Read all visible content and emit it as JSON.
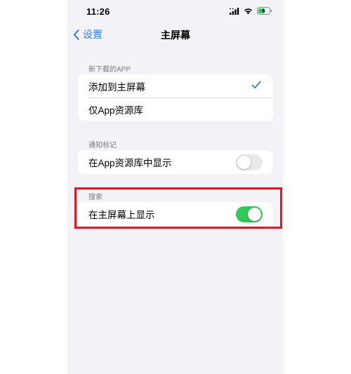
{
  "status_bar": {
    "time": "11:26"
  },
  "nav": {
    "back_label": "设置",
    "title": "主屏幕"
  },
  "sections": {
    "new_downloads": {
      "header": "新下载的APP",
      "rows": [
        {
          "label": "添加到主屏幕",
          "selected": true
        },
        {
          "label": "仅App资源库",
          "selected": false
        }
      ]
    },
    "notification_badges": {
      "header": "通知标记",
      "rows": [
        {
          "label": "在App资源库中显示",
          "toggle": false
        }
      ]
    },
    "search": {
      "header": "搜索",
      "rows": [
        {
          "label": "在主屏幕上显示",
          "toggle": true
        }
      ]
    }
  },
  "colors": {
    "accent": "#2f7cf6",
    "toggle_on": "#34c759",
    "highlight_box": "#e3171f"
  }
}
